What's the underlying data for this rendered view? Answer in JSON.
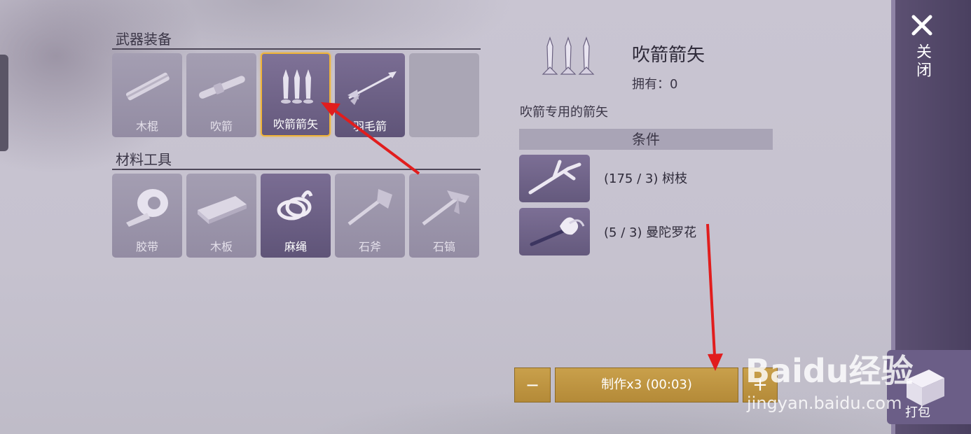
{
  "sections": {
    "weapons": {
      "title": "武器装备",
      "items": [
        {
          "label": "木棍",
          "icon": "wooden-stick"
        },
        {
          "label": "吹箭",
          "icon": "blowgun"
        },
        {
          "label": "吹箭箭矢",
          "icon": "blowgun-darts",
          "selected": true
        },
        {
          "label": "羽毛箭",
          "icon": "feather-arrow"
        },
        {
          "label": "",
          "icon": ""
        }
      ]
    },
    "materials": {
      "title": "材料工具",
      "items": [
        {
          "label": "胶带",
          "icon": "tape"
        },
        {
          "label": "木板",
          "icon": "wood-plank"
        },
        {
          "label": "麻绳",
          "icon": "rope"
        },
        {
          "label": "石斧",
          "icon": "stone-axe"
        },
        {
          "label": "石镐",
          "icon": "stone-pickaxe"
        }
      ]
    }
  },
  "detail": {
    "name": "吹箭箭矢",
    "owned_label": "拥有：",
    "owned_value": "0",
    "description": "吹箭专用的箭矢",
    "conditions_title": "条件",
    "requirements": [
      {
        "text": "(175 / 3) 树枝",
        "icon": "branch"
      },
      {
        "text": "(5 / 3) 曼陀罗花",
        "icon": "datura-flower"
      }
    ]
  },
  "actions": {
    "minus": "−",
    "make": "制作x3 (00:03)",
    "plus": "+"
  },
  "side": {
    "close_label": "关闭",
    "pack_label": "打包"
  },
  "watermark": {
    "brand": "Baidu经验",
    "url": "jingyan.baidu.com"
  },
  "colors": {
    "selected_border": "#f0b438",
    "button_gold": "#c9a04b",
    "arrow_red": "#e11d1d",
    "side_panel": "#4a4060"
  }
}
